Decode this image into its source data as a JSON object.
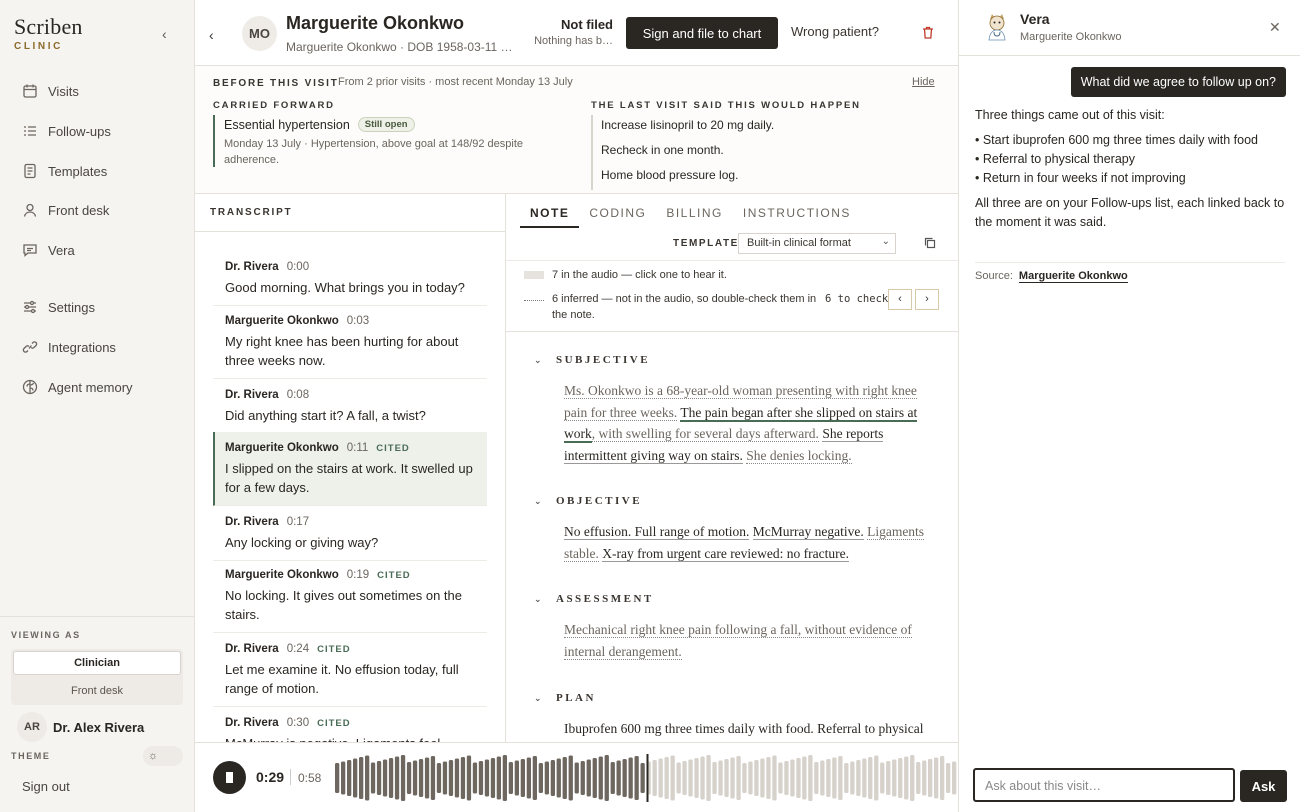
{
  "brand": {
    "name": "Scriben",
    "sub": "CLINIC"
  },
  "nav": [
    {
      "label": "Visits",
      "icon": "calendar-icon"
    },
    {
      "label": "Follow-ups",
      "icon": "list-icon"
    },
    {
      "label": "Templates",
      "icon": "document-icon"
    },
    {
      "label": "Front desk",
      "icon": "person-icon"
    },
    {
      "label": "Vera",
      "icon": "chat-icon"
    },
    {
      "label": "Settings",
      "icon": "sliders-icon"
    },
    {
      "label": "Integrations",
      "icon": "link-icon"
    },
    {
      "label": "Agent memory",
      "icon": "brain-icon"
    }
  ],
  "viewing": {
    "label": "VIEWING AS",
    "active": "Clinician",
    "other": "Front desk"
  },
  "user": {
    "initials": "AR",
    "name": "Dr. Alex Rivera"
  },
  "theme": {
    "label": "THEME"
  },
  "signout": "Sign out",
  "header": {
    "initials": "MO",
    "name": "Marguerite Okonkwo",
    "meta": "Marguerite Okonkwo · DOB 1958-03-11 · …",
    "status": "Not filed",
    "status_sub": "Nothing has b…",
    "sign_button": "Sign and file to chart",
    "wrong_patient": "Wrong patient?"
  },
  "before": {
    "title": "BEFORE THIS VISIT",
    "sub": "From 2 prior visits · most recent Monday 13 July",
    "hide": "Hide",
    "carried_label": "CARRIED FORWARD",
    "carried": {
      "title": "Essential hypertension",
      "badge": "Still open",
      "text": "Monday 13 July · Hypertension, above goal at 148/92 despite adherence."
    },
    "last_label": "THE LAST VISIT SAID THIS WOULD HAPPEN",
    "last_items": [
      "Increase lisinopril to 20 mg daily.",
      "Recheck in one month.",
      "Home blood pressure log."
    ]
  },
  "transcript": {
    "title": "TRANSCRIPT",
    "cited_label": "CITED",
    "items": [
      {
        "speaker": "Dr. Rivera",
        "time": "0:00",
        "text": "Good morning. What brings you in today?",
        "cited": false
      },
      {
        "speaker": "Marguerite Okonkwo",
        "time": "0:03",
        "text": "My right knee has been hurting for about three weeks now.",
        "cited": false
      },
      {
        "speaker": "Dr. Rivera",
        "time": "0:08",
        "text": "Did anything start it? A fall, a twist?",
        "cited": false
      },
      {
        "speaker": "Marguerite Okonkwo",
        "time": "0:11",
        "text": "I slipped on the stairs at work. It swelled up for a few days.",
        "cited": true
      },
      {
        "speaker": "Dr. Rivera",
        "time": "0:17",
        "text": "Any locking or giving way?",
        "cited": false
      },
      {
        "speaker": "Marguerite Okonkwo",
        "time": "0:19",
        "text": "No locking. It gives out sometimes on the stairs.",
        "cited": true
      },
      {
        "speaker": "Dr. Rivera",
        "time": "0:24",
        "text": "Let me examine it. No effusion today, full range of motion.",
        "cited": true
      },
      {
        "speaker": "Dr. Rivera",
        "time": "0:30",
        "text": "McMurray is negative. Ligaments feel",
        "cited": true
      }
    ]
  },
  "note": {
    "tabs": [
      "NOTE",
      "CODING",
      "BILLING",
      "INSTRUCTIONS"
    ],
    "template_label": "TEMPLATE",
    "template_value": "Built-in clinical format",
    "legend_audio": "7 in the audio — click one to hear it.",
    "legend_inferred": "6 inferred — not in the audio, so double-check them in the note.",
    "to_check": "6 to check",
    "sections": {
      "subjective": {
        "title": "SUBJECTIVE",
        "p1": "Ms. Okonkwo is a 68-year-old woman presenting with right knee pain for three weeks.",
        "p2": "The pain began after she slipped on stairs at work",
        "p3": ", with swelling for several days afterward.",
        "p4": "She reports intermittent giving way on stairs.",
        "p5": "She denies locking."
      },
      "objective": {
        "title": "OBJECTIVE",
        "p1": "No effusion. Full range of motion.",
        "p2": "McMurray negative.",
        "p3": "Ligaments stable.",
        "p4": "X-ray from urgent care reviewed: no fracture."
      },
      "assessment": {
        "title": "ASSESSMENT",
        "p1": "Mechanical right knee pain following a fall, without evidence of internal derangement."
      },
      "plan": {
        "title": "PLAN",
        "p1": "Ibuprofen 600 mg three times daily with food. Referral to physical"
      }
    }
  },
  "player": {
    "current": "0:29",
    "total": "0:58",
    "progress": 0.5
  },
  "vera": {
    "name": "Vera",
    "sub": "Marguerite Okonkwo",
    "question": "What did we agree to follow up on?",
    "reply_intro": "Three things came out of this visit:",
    "reply_items": [
      "• Start ibuprofen 600 mg three times daily with food",
      "• Referral to physical therapy",
      "• Return in four weeks if not improving"
    ],
    "reply_outro": "All three are on your Follow-ups list, each linked back to the moment it was said.",
    "source_label": "Source:",
    "source_link": "Marguerite Okonkwo",
    "ask_placeholder": "Ask about this visit…",
    "ask_button": "Ask"
  }
}
